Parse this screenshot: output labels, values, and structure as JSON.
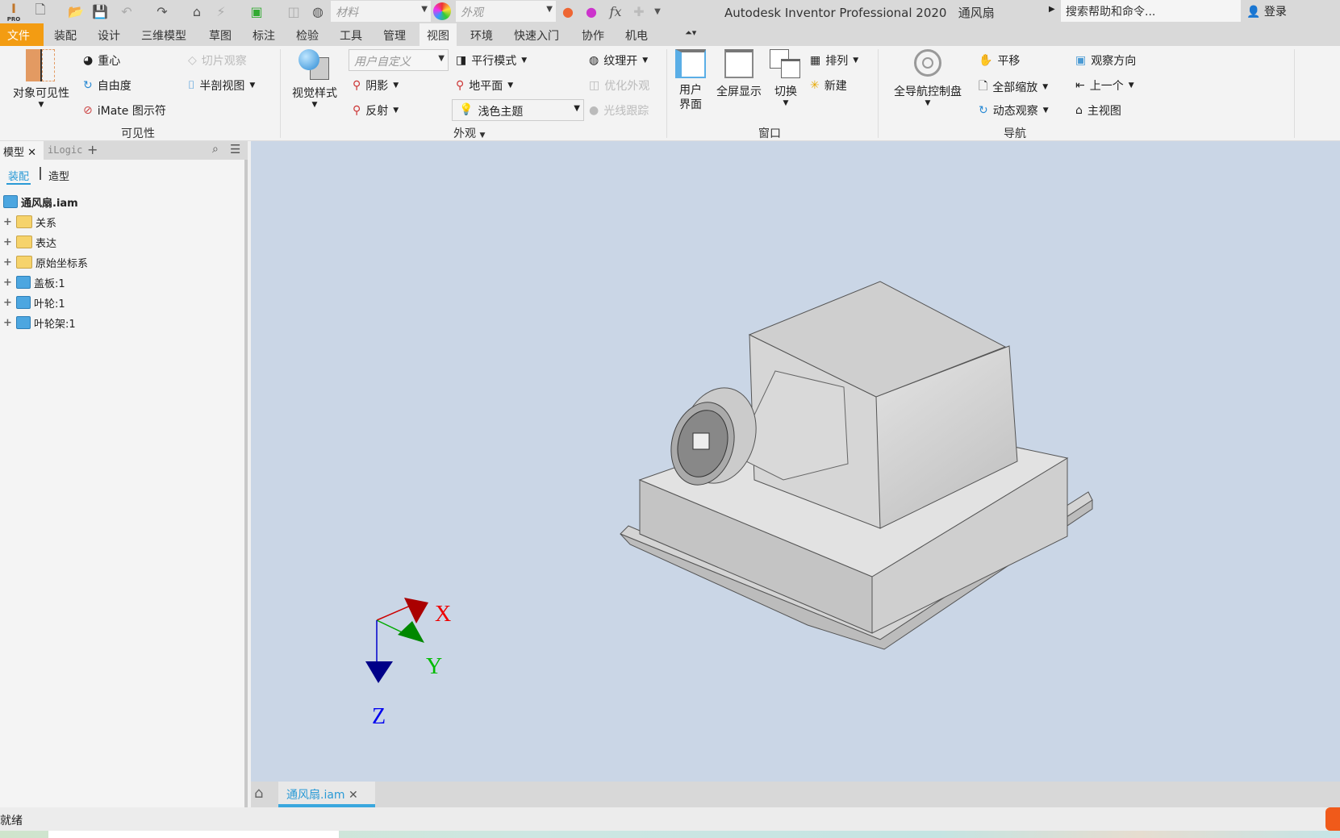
{
  "titlebar": {
    "app_title": "Autodesk Inventor Professional 2020",
    "doc_name": "通风扇",
    "material_placeholder": "材料",
    "appearance_placeholder": "外观",
    "search_placeholder": "搜索帮助和命令...",
    "login": "登录",
    "logo_text": "PRO"
  },
  "tabs": [
    "文件",
    "装配",
    "设计",
    "三维模型",
    "草图",
    "标注",
    "检验",
    "工具",
    "管理",
    "视图",
    "环境",
    "快速入门",
    "协作",
    "机电"
  ],
  "active_tab": "视图",
  "ribbon": {
    "visibility": {
      "label": "可见性",
      "object_visibility": "对象可见性",
      "center_of_gravity": "重心",
      "dof": "自由度",
      "imate": "iMate 图示符",
      "slice": "切片观察",
      "half_section": "半剖视图"
    },
    "appearance": {
      "label": "外观",
      "visual_style": "视觉样式",
      "style_select": "用户自定义",
      "shadows": "阴影",
      "reflection": "反射",
      "parallel": "平行模式",
      "ground": "地平面",
      "theme": "浅色主题",
      "texture": "纹理开",
      "optimize": "优化外观",
      "ray_tracing": "光线跟踪"
    },
    "window": {
      "label": "窗口",
      "user_interface_1": "用户",
      "user_interface_2": "界面",
      "fullscreen": "全屏显示",
      "switch": "切换",
      "arrange": "排列",
      "new": "新建"
    },
    "navigate": {
      "label": "导航",
      "full_nav_wheel": "全导航控制盘",
      "pan": "平移",
      "zoom_all": "全部缩放",
      "orbit": "动态观察",
      "look_at": "观察方向",
      "previous": "上一个",
      "home": "主视图"
    }
  },
  "browser": {
    "tab_model": "模型",
    "tab_ilogic": "iLogic",
    "mode_assembly": "装配",
    "mode_modeling": "造型",
    "root": "通风扇.iam",
    "items": [
      {
        "label": "关系",
        "icon": "folder"
      },
      {
        "label": "表达",
        "icon": "representation-folder"
      },
      {
        "label": "原始坐标系",
        "icon": "folder"
      },
      {
        "label": "盖板:1",
        "icon": "part-adaptive"
      },
      {
        "label": "叶轮:1",
        "icon": "part"
      },
      {
        "label": "叶轮架:1",
        "icon": "part-adaptive"
      }
    ]
  },
  "viewport": {
    "axis_x": "X",
    "axis_y": "Y",
    "axis_z": "Z",
    "background": "#cad6e6"
  },
  "doc_tab": {
    "label": "通风扇.iam"
  },
  "status": {
    "text": "就绪"
  },
  "colors": {
    "accent": "#f39c12",
    "active_blue": "#3aa7de"
  }
}
